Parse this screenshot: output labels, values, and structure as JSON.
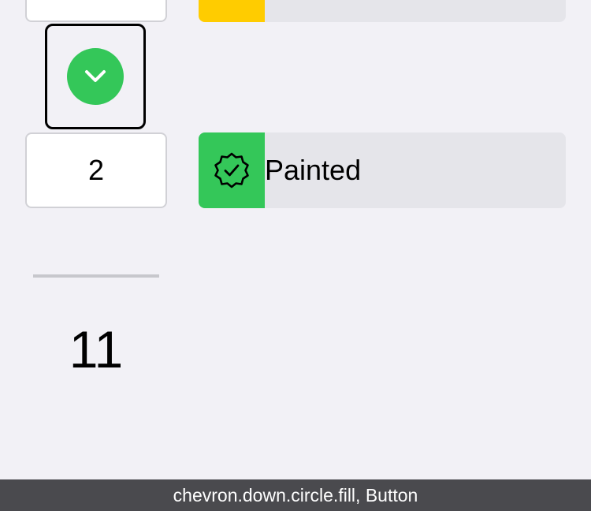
{
  "top_row": {
    "count": "",
    "swatch_color": "#ffcc00"
  },
  "focused_button": {
    "icon": "chevron-down-circle-fill-icon",
    "color": "#34c759"
  },
  "item_row": {
    "count": "2",
    "status_label": "Painted",
    "status_icon": "checkmark-seal-icon",
    "swatch_color": "#34c759"
  },
  "total": {
    "value": "11"
  },
  "accessibility_caption": {
    "text": "chevron.down.circle.fill, Button"
  },
  "colors": {
    "background": "#f2f1f6",
    "bar": "#e5e5ea",
    "caption_bg": "#4a4a4e"
  }
}
